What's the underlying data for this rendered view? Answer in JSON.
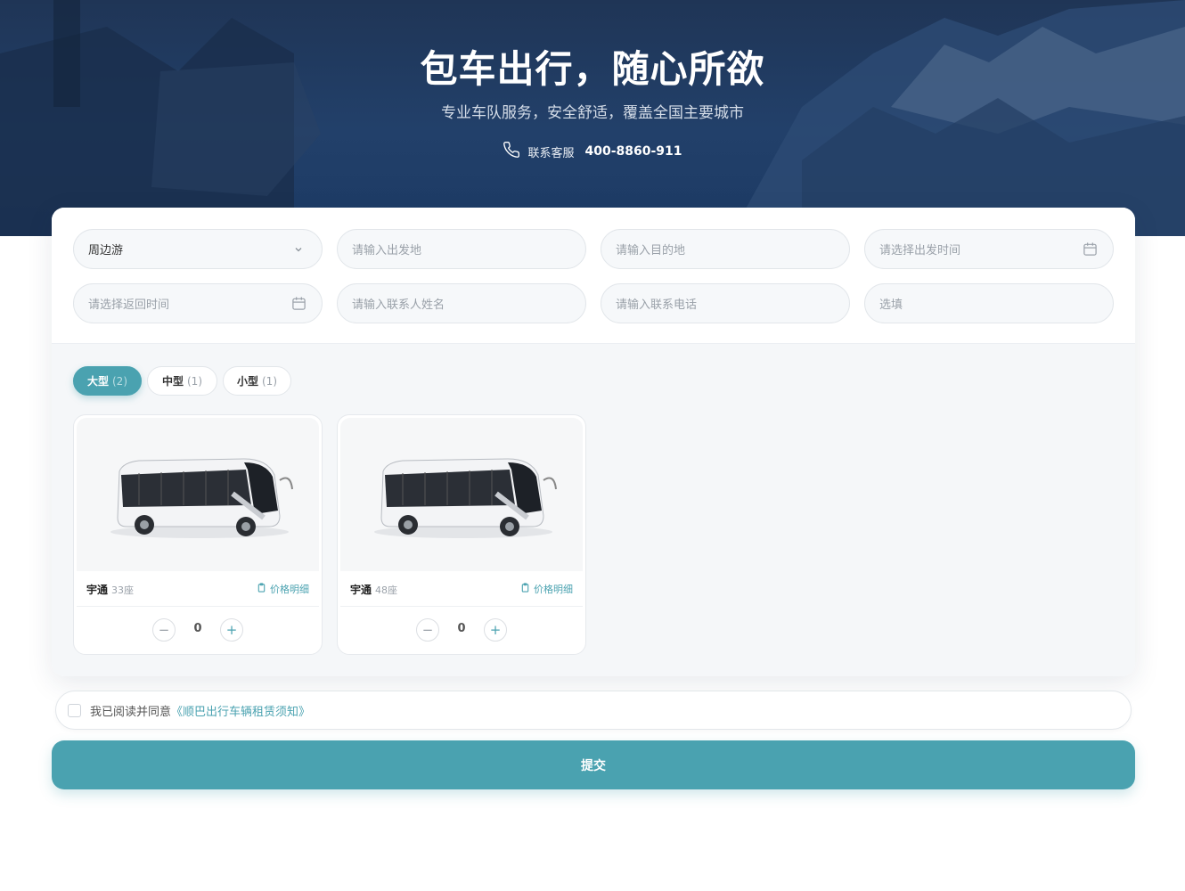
{
  "hero": {
    "title": "包车出行，随心所欲",
    "subtitle": "专业车队服务，安全舒适，覆盖全国主要城市",
    "contact_label": "联系客服",
    "contact_phone": "400-8860-911"
  },
  "form": {
    "trip_type": "周边游",
    "departure_placeholder": "请输入出发地",
    "destination_placeholder": "请输入目的地",
    "depart_time_placeholder": "请选择出发时间",
    "return_time_placeholder": "请选择返回时间",
    "contact_name_placeholder": "请输入联系人姓名",
    "contact_phone_placeholder": "请输入联系电话",
    "optional_placeholder": "选填"
  },
  "tabs": [
    {
      "label": "大型",
      "count": "(2)",
      "active": true
    },
    {
      "label": "中型",
      "count": "(1)",
      "active": false
    },
    {
      "label": "小型",
      "count": "(1)",
      "active": false
    }
  ],
  "vehicles": [
    {
      "brand": "宇通",
      "seats": "33座",
      "price_label": "价格明细",
      "quantity": "0"
    },
    {
      "brand": "宇通",
      "seats": "48座",
      "price_label": "价格明细",
      "quantity": "0"
    }
  ],
  "agreement": {
    "text": "我已阅读并同意",
    "link": "《顺巴出行车辆租赁须知》"
  },
  "submit_label": "提交",
  "colors": {
    "accent": "#4aa2b0",
    "hero": "#22406a"
  },
  "icons": [
    "phone-icon",
    "chevron-down-icon",
    "calendar-icon",
    "clipboard-icon",
    "minus-icon",
    "plus-icon"
  ]
}
